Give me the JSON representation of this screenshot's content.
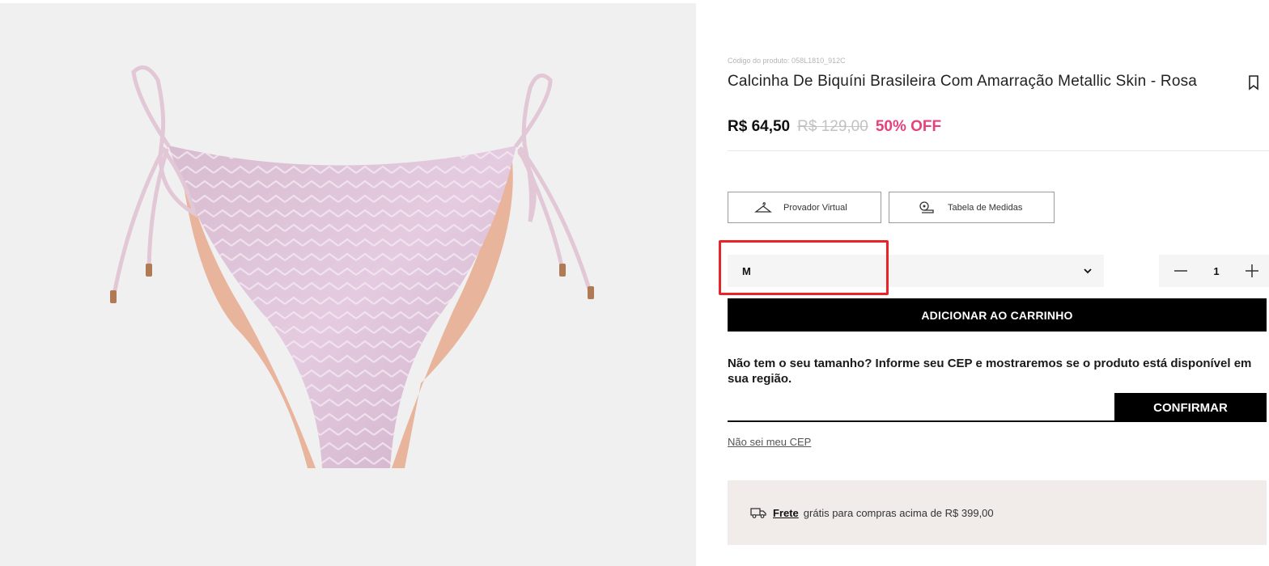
{
  "product": {
    "code_label": "Código do produto: 058L1810_912C",
    "title": "Calcinha De Biquíni Brasileira Com Amarração Metallic Skin - Rosa",
    "price": "R$ 64,50",
    "old_price": "R$ 129,00",
    "discount": "50% OFF",
    "image_alt": "Calcinha de biquíni rosa metálica com amarração lateral"
  },
  "tools": {
    "provador_label": "Provador Virtual",
    "tabela_label": "Tabela de Medidas"
  },
  "size": {
    "selected": "M"
  },
  "quantity": {
    "value": "1"
  },
  "cart": {
    "add_label": "ADICIONAR AO CARRINHO"
  },
  "cep": {
    "message": "Não tem o seu tamanho? Informe seu CEP e mostraremos se o produto está disponível em sua região.",
    "input_value": "",
    "confirm_label": "CONFIRMAR",
    "unknown_link": "Não sei meu CEP"
  },
  "shipping": {
    "link_label": "Frete",
    "text": "grátis para compras acima de R$ 399,00"
  },
  "colors": {
    "discount": "#e6417c",
    "highlight": "#e8232a",
    "button_bg": "#000000",
    "shipping_bg": "#f1ecea"
  }
}
